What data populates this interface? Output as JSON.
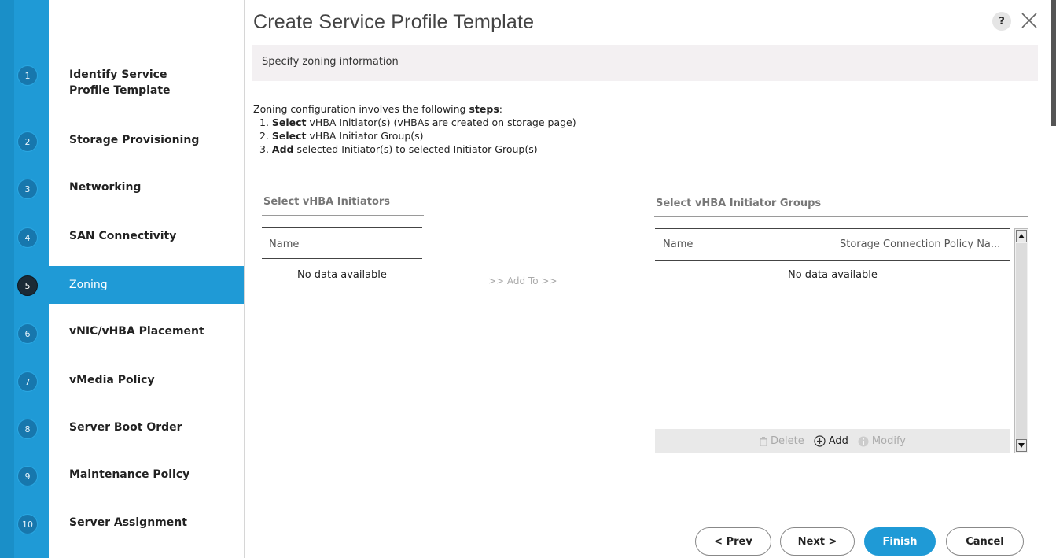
{
  "dialog": {
    "title": "Create Service Profile Template",
    "help_label": "?",
    "help_icon": "question-icon",
    "close_icon": "close-icon"
  },
  "steps": [
    {
      "number": "1",
      "label": "Identify Service Profile Template"
    },
    {
      "number": "2",
      "label": "Storage Provisioning"
    },
    {
      "number": "3",
      "label": "Networking"
    },
    {
      "number": "4",
      "label": "SAN Connectivity"
    },
    {
      "number": "5",
      "label": "Zoning",
      "active": true
    },
    {
      "number": "6",
      "label": "vNIC/vHBA Placement"
    },
    {
      "number": "7",
      "label": "vMedia Policy"
    },
    {
      "number": "8",
      "label": "Server Boot Order"
    },
    {
      "number": "9",
      "label": "Maintenance Policy"
    },
    {
      "number": "10",
      "label": "Server Assignment"
    }
  ],
  "banner": "Specify zoning information",
  "intro": {
    "lead_a": "Zoning configuration involves the following ",
    "lead_b": "steps",
    "lead_c": ":",
    "items": [
      {
        "num": "1. ",
        "verb": "Select",
        "rest": " vHBA Initiator(s) (vHBAs are created on storage page)"
      },
      {
        "num": "2. ",
        "verb": "Select",
        "rest": " vHBA Initiator Group(s)"
      },
      {
        "num": "3. ",
        "verb": "Add",
        "rest": " selected Initiator(s) to selected Initiator Group(s)"
      }
    ]
  },
  "initiators": {
    "title": "Select vHBA Initiators",
    "col_name": "Name",
    "empty": "No data available"
  },
  "add_to_label": ">> Add To >>",
  "groups": {
    "title": "Select vHBA Initiator Groups",
    "col_name": "Name",
    "col_policy": "Storage Connection Policy Na...",
    "empty": "No data available",
    "toolbar": {
      "delete": "Delete",
      "add": "Add",
      "modify": "Modify"
    }
  },
  "footer": {
    "prev": "< Prev",
    "next": "Next >",
    "finish": "Finish",
    "cancel": "Cancel"
  },
  "colors": {
    "accent": "#1f9ad6",
    "active_step_circle": "#1b2a36"
  }
}
